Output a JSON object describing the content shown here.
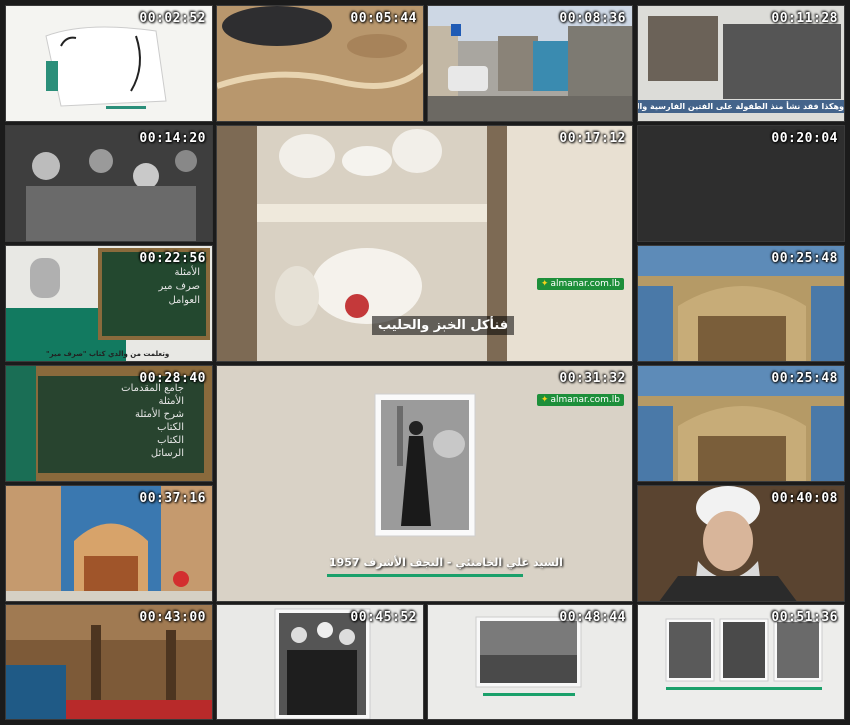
{
  "thumbnails": [
    {
      "timestamp": "00:02:52"
    },
    {
      "timestamp": "00:05:44"
    },
    {
      "timestamp": "00:08:36"
    },
    {
      "timestamp": "00:11:28",
      "caption": "وهكذا فقد نشأ منذ الطفولة على الفتين الفارسية والتركية"
    },
    {
      "timestamp": "00:14:20"
    },
    {
      "timestamp": "00:17:12",
      "caption": "فنأكل الخبز والحليب",
      "logo": "almanar.com.lb"
    },
    {
      "timestamp": "00:20:04"
    },
    {
      "timestamp": "00:22:56",
      "caption": "وتعلمت من والدي كتاب \"صرف مير\""
    },
    {
      "timestamp": "00:25:48"
    },
    {
      "timestamp": "00:28:40"
    },
    {
      "timestamp": "00:31:32",
      "caption": "السيد علي الخامنئي - النجف الأشرف 1957",
      "logo": "almanar.com.lb"
    },
    {
      "timestamp": "00:25:48"
    },
    {
      "timestamp": "00:37:16"
    },
    {
      "timestamp": "00:40:08"
    },
    {
      "timestamp": "00:43:00"
    },
    {
      "timestamp": "00:45:52"
    },
    {
      "timestamp": "00:48:44"
    },
    {
      "timestamp": "00:51:36"
    }
  ],
  "chalkboard_1": [
    "الأمثلة",
    "صرف مير",
    "العوامل"
  ],
  "chalkboard_2": [
    "جامع المقدمات",
    "الأمثلة",
    "شرح الأمثلة",
    "الكتاب",
    "الكتاب",
    "الرسائل"
  ]
}
